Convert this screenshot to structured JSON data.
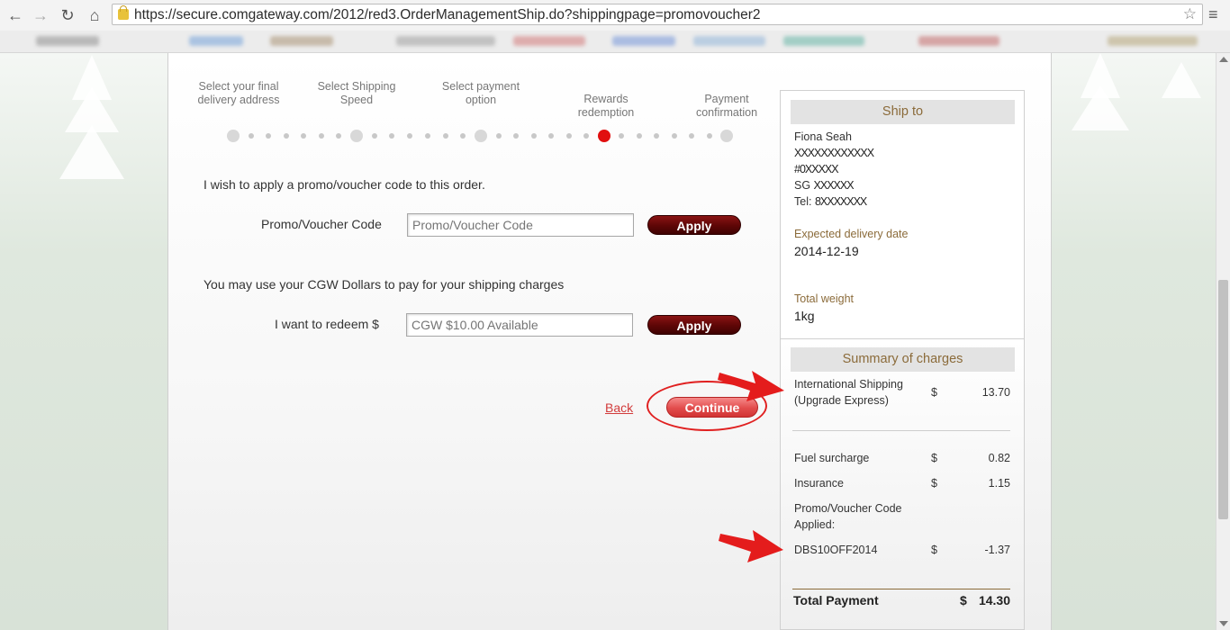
{
  "browser": {
    "url": "https://secure.comgateway.com/2012/red3.OrderManagementShip.do?shippingpage=promovoucher2"
  },
  "steps": [
    {
      "label": "Select your final delivery address"
    },
    {
      "label": "Select Shipping Speed"
    },
    {
      "label": "Select payment option"
    },
    {
      "label": "Rewards redemption"
    },
    {
      "label": "Payment confirmation"
    }
  ],
  "progress": {
    "current_step": 4,
    "total_steps": 5
  },
  "promo": {
    "intro": "I wish to apply a promo/voucher code to this order.",
    "label": "Promo/Voucher Code",
    "placeholder": "Promo/Voucher Code",
    "button": "Apply"
  },
  "cgw": {
    "intro": "You may use your CGW Dollars to pay for your shipping charges",
    "label": "I want to redeem $",
    "placeholder": "CGW $10.00 Available",
    "button": "Apply"
  },
  "actions": {
    "back": "Back",
    "continue": "Continue"
  },
  "ship_to": {
    "title": "Ship to",
    "name": "Fiona Seah",
    "line1": "XXXXXXXXXXXX",
    "line2": "#0XXXXX",
    "line3_prefix": "SG",
    "line3": "XXXXXX",
    "tel_prefix": "Tel:",
    "tel": "8XXXXXXX",
    "delivery_label": "Expected delivery date",
    "delivery_value": "2014-12-19",
    "weight_label": "Total weight",
    "weight_value": "1kg"
  },
  "summary": {
    "title": "Summary of charges",
    "intl_label_1": "International Shipping",
    "intl_label_2": "(Upgrade Express)",
    "intl_cur": "$",
    "intl_amt": "13.70",
    "fuel_label": "Fuel surcharge",
    "fuel_cur": "$",
    "fuel_amt": "0.82",
    "ins_label": "Insurance",
    "ins_cur": "$",
    "ins_amt": "1.15",
    "promo_label_1": "Promo/Voucher Code",
    "promo_label_2": "Applied:",
    "promo_code": "DBS10OFF2014",
    "promo_cur": "$",
    "promo_amt": "-1.37",
    "total_label": "Total Payment",
    "total_cur": "$",
    "total_amt": "14.30"
  },
  "colors": {
    "accent_red": "#e10f0f",
    "brand_brown": "#8b6b3a",
    "button_dark": "#5d0606"
  }
}
